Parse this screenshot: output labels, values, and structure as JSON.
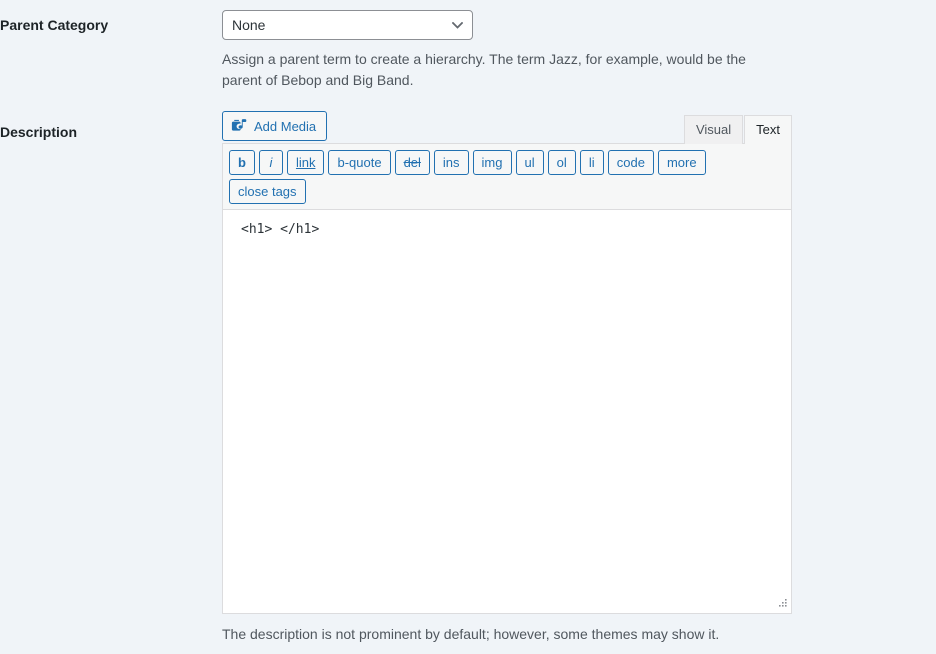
{
  "form": {
    "rows": [
      {
        "label": "Parent Category",
        "field_type": "select",
        "selected": "None",
        "options": [
          "None"
        ],
        "help": "Assign a parent term to create a hierarchy. The term Jazz, for example, would be the parent of Bebop and Big Band."
      },
      {
        "label": "Description",
        "field_type": "editor",
        "help": "The description is not prominent by default; however, some themes may show it."
      }
    ]
  },
  "editor": {
    "add_media_label": "Add Media",
    "add_media_icon": "media-icon",
    "tabs": [
      {
        "label": "Visual",
        "active": false
      },
      {
        "label": "Text",
        "active": true
      }
    ],
    "quicktags": [
      {
        "label": "b",
        "style": "b"
      },
      {
        "label": "i",
        "style": "i"
      },
      {
        "label": "link",
        "style": "u"
      },
      {
        "label": "b-quote",
        "style": ""
      },
      {
        "label": "del",
        "style": "s"
      },
      {
        "label": "ins",
        "style": ""
      },
      {
        "label": "img",
        "style": ""
      },
      {
        "label": "ul",
        "style": ""
      },
      {
        "label": "ol",
        "style": ""
      },
      {
        "label": "li",
        "style": ""
      },
      {
        "label": "code",
        "style": ""
      },
      {
        "label": "more",
        "style": ""
      },
      {
        "label": "close tags",
        "style": ""
      }
    ],
    "content": "<h1> </h1>",
    "resize_handle_icon": "resize-grip-icon"
  },
  "colors": {
    "page_background": "#f0f4f8",
    "accent_blue": "#2271b1",
    "label_text": "#1d2327",
    "help_text": "#50575e",
    "border": "#dcdcde",
    "select_border": "#8c8f94"
  }
}
